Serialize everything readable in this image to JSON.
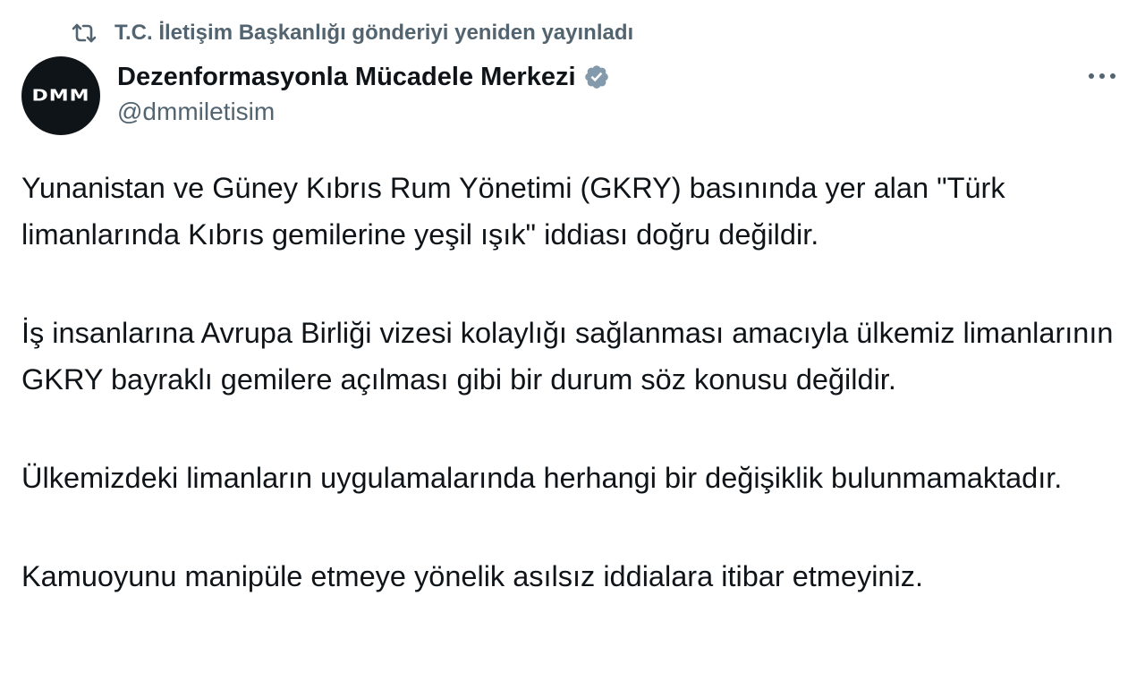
{
  "repost": {
    "icon": "repost-icon",
    "text": "T.C. İletişim Başkanlığı gönderiyi yeniden yayınladı"
  },
  "author": {
    "avatar_text": "DMM",
    "display_name": "Dezenformasyonla Mücadele Merkezi",
    "verified_icon": "verified-badge-icon",
    "verified_color": "#829aab",
    "handle": "@dmmiletisim"
  },
  "more_menu": {
    "icon": "more-horizontal-icon"
  },
  "tweet": {
    "paragraphs": [
      "Yunanistan ve Güney Kıbrıs Rum Yönetimi (GKRY) basınında yer alan \"Türk limanlarında Kıbrıs gemilerine yeşil ışık\" iddiası doğru değildir.",
      "İş insanlarına Avrupa Birliği vizesi kolaylığı sağlanması amacıyla ülkemiz limanlarının GKRY bayraklı gemilere açılması gibi bir durum söz konusu değildir.",
      "Ülkemizdeki limanların uygulamalarında herhangi bir değişiklik bulunmamaktadır.",
      "Kamuoyunu manipüle etmeye yönelik asılsız iddialara itibar etmeyiniz."
    ]
  },
  "colors": {
    "text_primary": "#0f1419",
    "text_secondary": "#536471",
    "background": "#ffffff"
  }
}
